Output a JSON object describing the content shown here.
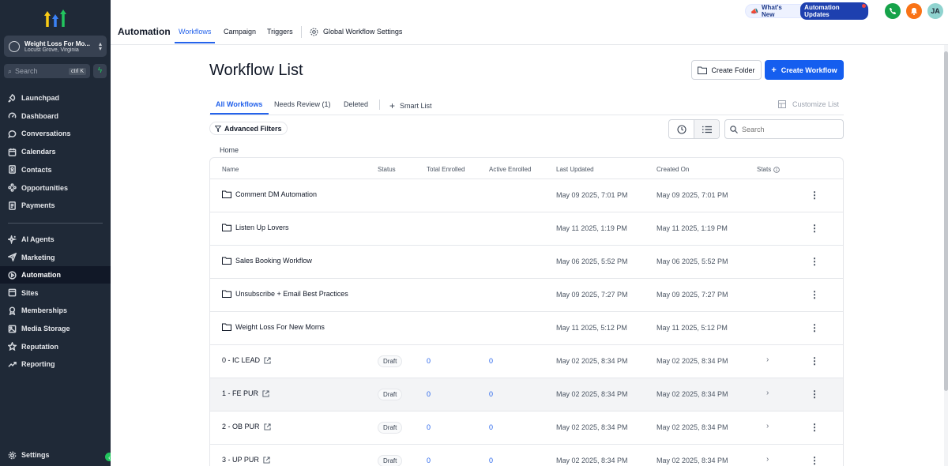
{
  "sidebar": {
    "account": {
      "name": "Weight Loss For Mo...",
      "location": "Locust Grove, Virginia"
    },
    "search": {
      "placeholder": "Search",
      "shortcut": "ctrl K"
    },
    "nav_top": [
      {
        "label": "Launchpad",
        "icon": "rocket-icon"
      },
      {
        "label": "Dashboard",
        "icon": "dashboard-icon"
      },
      {
        "label": "Conversations",
        "icon": "chat-icon"
      },
      {
        "label": "Calendars",
        "icon": "calendar-icon"
      },
      {
        "label": "Contacts",
        "icon": "contacts-icon"
      },
      {
        "label": "Opportunities",
        "icon": "opportunities-icon"
      },
      {
        "label": "Payments",
        "icon": "payments-icon"
      }
    ],
    "nav_bottom": [
      {
        "label": "AI Agents",
        "icon": "ai-sparkle-icon"
      },
      {
        "label": "Marketing",
        "icon": "send-icon"
      },
      {
        "label": "Automation",
        "icon": "automation-icon",
        "active": true
      },
      {
        "label": "Sites",
        "icon": "sites-icon"
      },
      {
        "label": "Memberships",
        "icon": "award-icon"
      },
      {
        "label": "Media Storage",
        "icon": "image-icon"
      },
      {
        "label": "Reputation",
        "icon": "star-icon"
      },
      {
        "label": "Reporting",
        "icon": "trend-icon"
      }
    ],
    "settings_label": "Settings"
  },
  "header": {
    "app_title": "Automation",
    "tabs": [
      "Workflows",
      "Campaign",
      "Triggers"
    ],
    "settings_link": "Global Workflow Settings",
    "whats_new": "What's New",
    "updates_pill": "Automation Updates",
    "user_initials": "JA"
  },
  "page": {
    "title": "Workflow List",
    "create_folder": "Create Folder",
    "create_workflow": "Create Workflow",
    "subtabs": [
      "All Workflows",
      "Needs Review (1)",
      "Deleted"
    ],
    "smart_list": "Smart List",
    "customize_list": "Customize List",
    "advanced_filters": "Advanced Filters",
    "search_placeholder": "Search",
    "breadcrumb": "Home"
  },
  "table": {
    "columns": [
      "Name",
      "Status",
      "Total Enrolled",
      "Active Enrolled",
      "Last Updated",
      "Created On",
      "Stats"
    ],
    "folders": [
      {
        "name": "Comment DM Automation",
        "updated": "May 09 2025, 7:01 PM",
        "created": "May 09 2025, 7:01 PM"
      },
      {
        "name": "Listen Up Lovers",
        "updated": "May 11 2025, 1:19 PM",
        "created": "May 11 2025, 1:19 PM"
      },
      {
        "name": "Sales Booking Workflow",
        "updated": "May 06 2025, 5:52 PM",
        "created": "May 06 2025, 5:52 PM"
      },
      {
        "name": "Unsubscribe + Email Best Practices",
        "updated": "May 09 2025, 7:27 PM",
        "created": "May 09 2025, 7:27 PM"
      },
      {
        "name": "Weight Loss For New Moms",
        "updated": "May 11 2025, 5:12 PM",
        "created": "May 11 2025, 5:12 PM"
      }
    ],
    "workflows": [
      {
        "name": "0 - IC LEAD",
        "status": "Draft",
        "total": "0",
        "active": "0",
        "updated": "May 02 2025, 8:34 PM",
        "created": "May 02 2025, 8:34 PM"
      },
      {
        "name": "1 - FE PUR",
        "status": "Draft",
        "total": "0",
        "active": "0",
        "updated": "May 02 2025, 8:34 PM",
        "created": "May 02 2025, 8:34 PM"
      },
      {
        "name": "2 - OB PUR",
        "status": "Draft",
        "total": "0",
        "active": "0",
        "updated": "May 02 2025, 8:34 PM",
        "created": "May 02 2025, 8:34 PM"
      },
      {
        "name": "3 - UP PUR",
        "status": "Draft",
        "total": "0",
        "active": "0",
        "updated": "May 02 2025, 8:34 PM",
        "created": "May 02 2025, 8:34 PM"
      }
    ]
  },
  "colors": {
    "accent": "#155eef",
    "sidebar_bg": "#1f2937",
    "call_green": "#16a34a",
    "bell_orange": "#f97316",
    "avatar_teal": "#8fd3cf"
  }
}
